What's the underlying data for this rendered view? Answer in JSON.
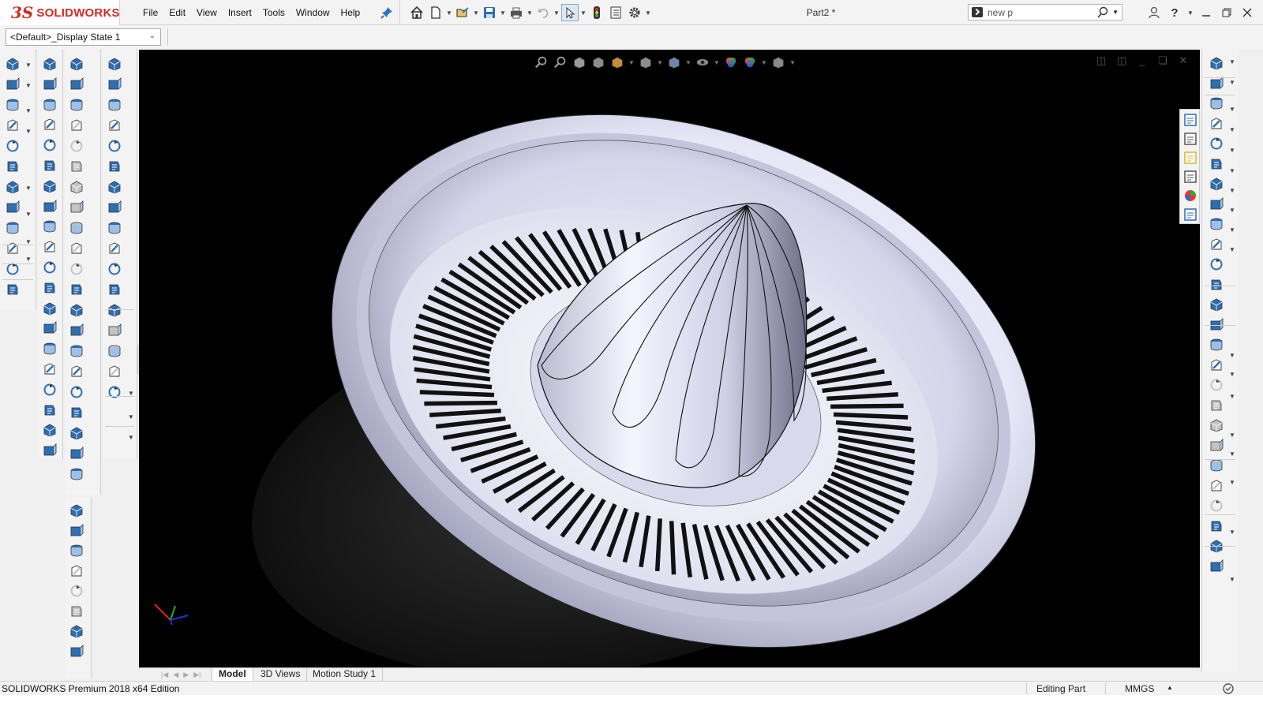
{
  "app": {
    "logo_brand": "3S",
    "logo_text": "SOLIDWORKS",
    "document_title": "Part2 *"
  },
  "menu": {
    "items": [
      "File",
      "Edit",
      "View",
      "Insert",
      "Tools",
      "Window",
      "Help"
    ]
  },
  "quick_access": {
    "icons": [
      "home-icon",
      "new-document-icon",
      "open-icon",
      "save-icon",
      "print-icon",
      "undo-icon",
      "select-arrow-icon",
      "traffic-light-icon",
      "file-properties-icon",
      "options-gear-icon"
    ]
  },
  "search": {
    "value": "new p",
    "placeholder": ""
  },
  "window_controls": {
    "icons": [
      "user-icon",
      "help-icon",
      "minimize-icon",
      "restore-icon",
      "close-icon"
    ]
  },
  "config": {
    "selected": "<Default>_Display State 1"
  },
  "viewport": {
    "background_color": "#000000",
    "model_color": "#dfe0f4",
    "heads_up_icons": [
      "zoom-to-fit-icon",
      "zoom-area-icon",
      "previous-view-icon",
      "section-view-icon",
      "dynamic-annotation-icon",
      "view-orientation-icon",
      "display-style-icon",
      "hide-show-icon",
      "edit-appearance-icon",
      "apply-scene-icon",
      "view-settings-icon"
    ]
  },
  "tabs": {
    "items": [
      "Model",
      "3D Views",
      "Motion Study 1"
    ],
    "active": "Model"
  },
  "status": {
    "product": "SOLIDWORKS Premium 2018 x64 Edition",
    "mode": "Editing Part",
    "units": "MMGS"
  },
  "colors": {
    "brand_red": "#d52b1e",
    "toolbar_bg": "#f3f3f3",
    "icon_blue": "#2d6fb5"
  }
}
